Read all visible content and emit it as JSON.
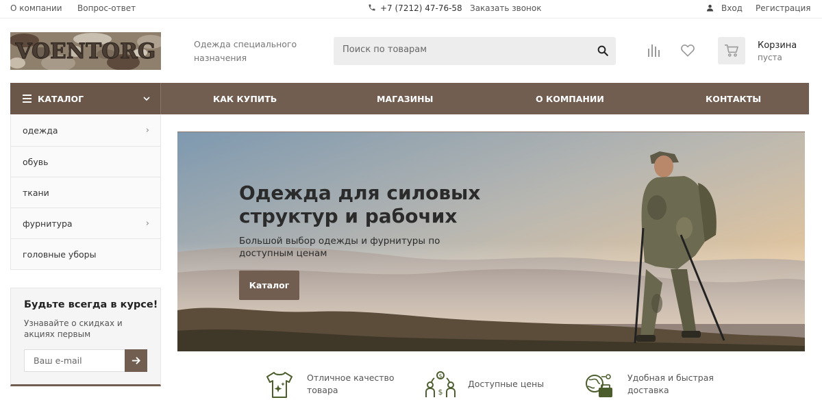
{
  "topbar": {
    "about": "О компании",
    "faq": "Вопрос-ответ",
    "phone": "+7 (7212) 47-76-58",
    "callback": "Заказать звонок",
    "login": "Вход",
    "register": "Регистрация"
  },
  "header": {
    "logo_text": "VOENTORG",
    "tagline": "Одежда специального назначения",
    "search_placeholder": "Поиск по товарам",
    "cart_title": "Корзина",
    "cart_status": "пуста"
  },
  "nav": {
    "catalog": "КАТАЛОГ",
    "items": [
      "КАК КУПИТЬ",
      "МАГАЗИНЫ",
      "О КОМПАНИИ",
      "КОНТАКТЫ"
    ]
  },
  "sidebar": {
    "items": [
      {
        "label": "одежда",
        "has_children": true
      },
      {
        "label": "обувь",
        "has_children": false
      },
      {
        "label": "ткани",
        "has_children": false
      },
      {
        "label": "фурнитура",
        "has_children": true
      },
      {
        "label": "головные уборы",
        "has_children": false
      }
    ]
  },
  "subscribe": {
    "title": "Будьте всегда в курсе!",
    "text": "Узнавайте о скидках и акциях первым",
    "placeholder": "Ваш e-mail"
  },
  "banner": {
    "title": "Одежда для силовых структур и рабочих",
    "subtitle": "Большой выбор одежды и фурнитуры по доступным ценам",
    "button": "Каталог"
  },
  "features": [
    {
      "icon": "tshirt-icon",
      "text": "Отличное качество товара"
    },
    {
      "icon": "prices-icon",
      "text": "Доступные цены"
    },
    {
      "icon": "delivery-icon",
      "text": "Удобная и быстрая доставка"
    }
  ],
  "colors": {
    "accent": "#725e51",
    "icon_green": "#4b5d2c"
  }
}
